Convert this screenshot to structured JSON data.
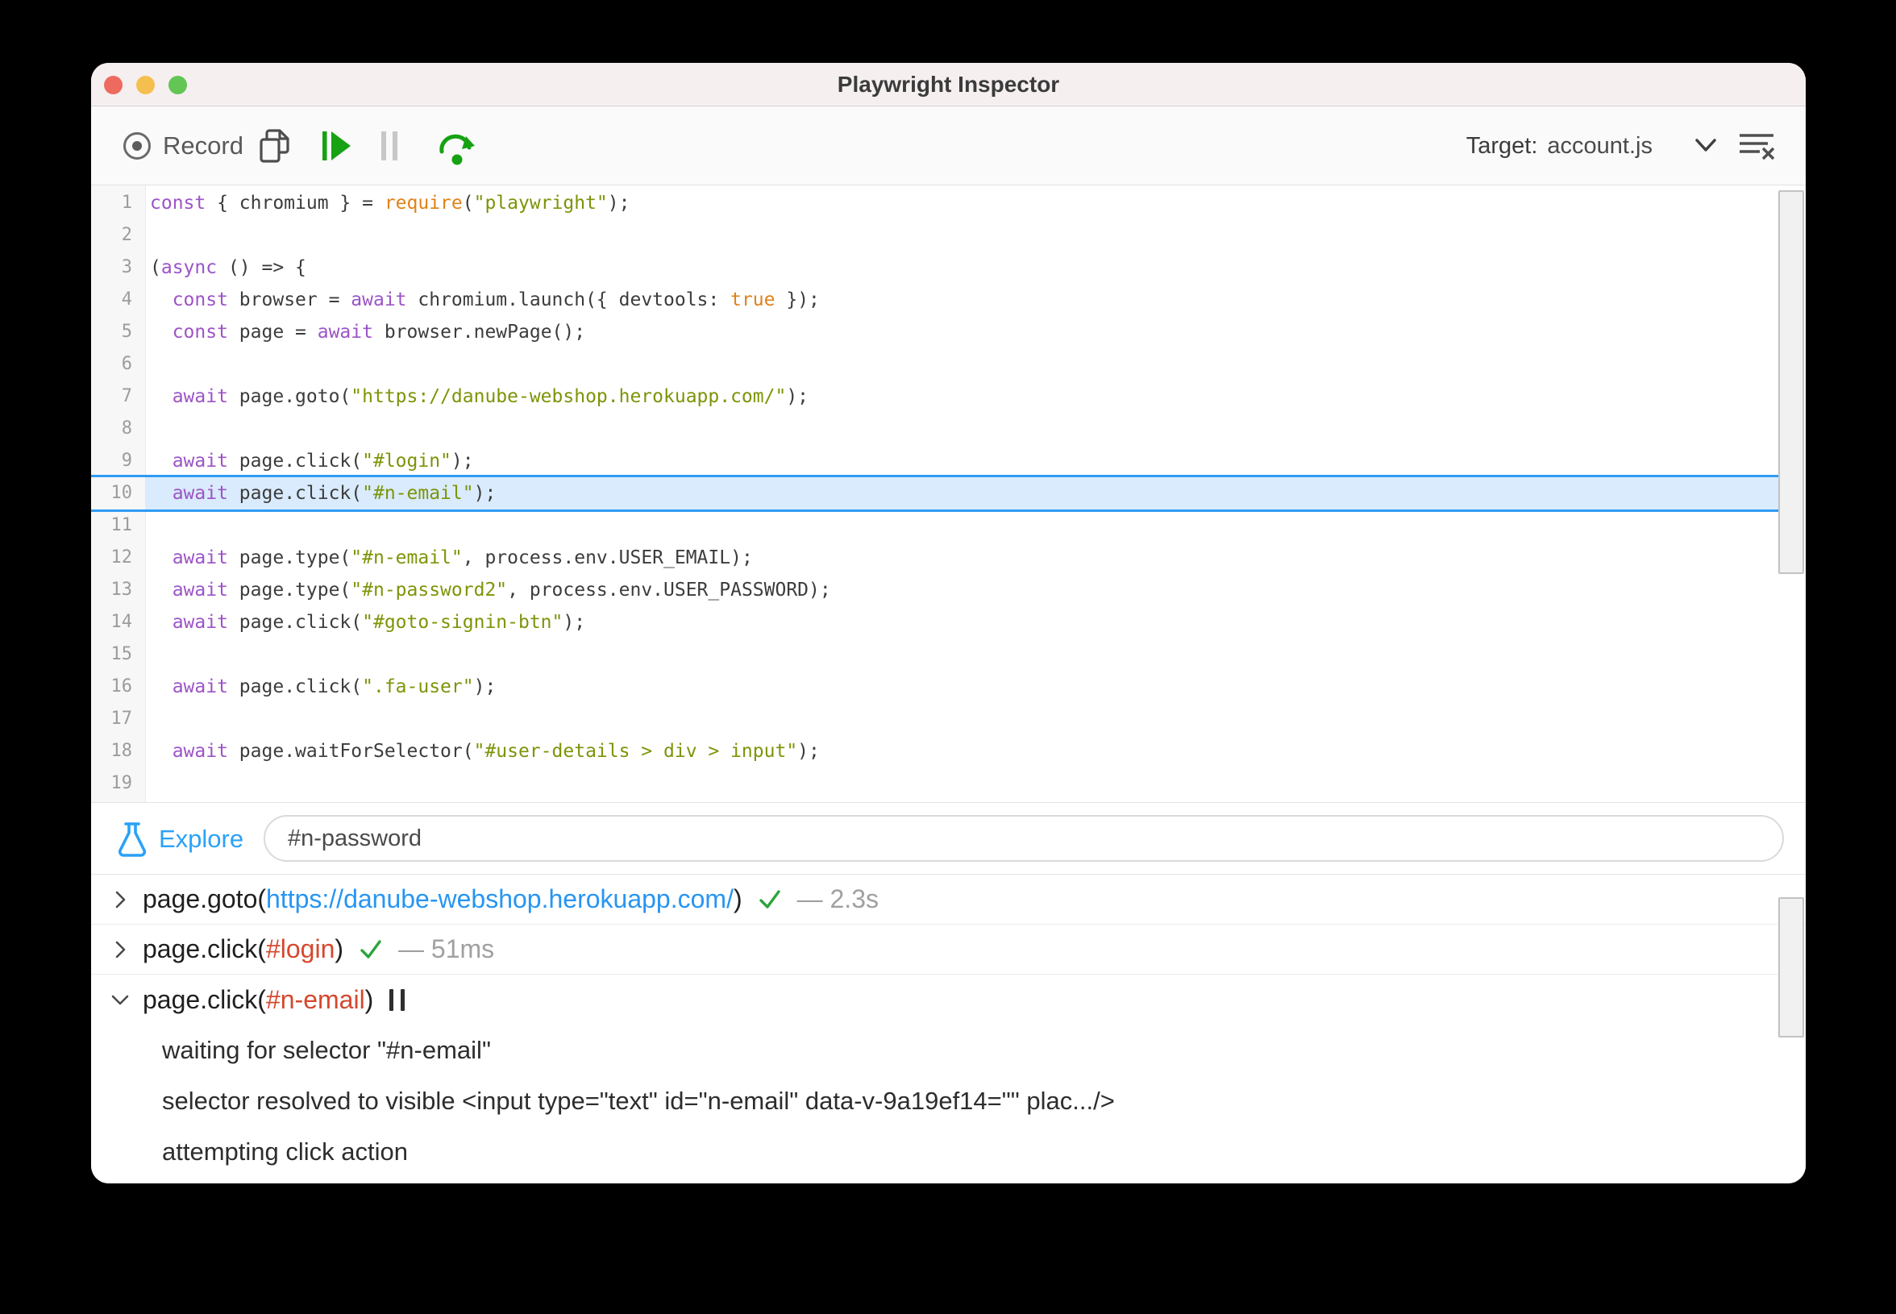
{
  "window": {
    "title": "Playwright Inspector"
  },
  "titlebar_buttons": [
    "close-button",
    "minimize-button",
    "zoom-button"
  ],
  "toolbar": {
    "record_label": "Record",
    "target_label": "Target:",
    "target_value": "account.js",
    "icons": [
      "record-icon",
      "copy-icon",
      "resume-icon",
      "pause-icon",
      "step-over-icon",
      "chevron-down-icon",
      "clear-log-icon"
    ]
  },
  "colors": {
    "accent_blue": "#2aa1f7",
    "link_blue": "#2795f2",
    "selector_red": "#d5482d",
    "success_green": "#2aa53c",
    "action_green": "#16a212",
    "highlight_fill": "#d9ebfc",
    "highlight_border": "#2f9bf5",
    "keyword_purple": "#9c54c6",
    "string_olive": "#7d9408",
    "builtin_orange": "#e08218",
    "traffic_red": "#ed6a5e",
    "traffic_yellow": "#f5bf4f",
    "traffic_green": "#62c554"
  },
  "editor": {
    "active_line": 10,
    "lines": [
      {
        "n": 1,
        "tokens": [
          {
            "t": "const",
            "c": "k"
          },
          {
            "t": " { chromium } = ",
            "c": "p"
          },
          {
            "t": "require",
            "c": "b"
          },
          {
            "t": "(",
            "c": "p"
          },
          {
            "t": "\"playwright\"",
            "c": "s"
          },
          {
            "t": ");",
            "c": "p"
          }
        ]
      },
      {
        "n": 2,
        "tokens": []
      },
      {
        "n": 3,
        "tokens": [
          {
            "t": "(",
            "c": "p"
          },
          {
            "t": "async",
            "c": "k"
          },
          {
            "t": " () => {",
            "c": "p"
          }
        ]
      },
      {
        "n": 4,
        "tokens": [
          {
            "t": "  ",
            "c": "p"
          },
          {
            "t": "const",
            "c": "k"
          },
          {
            "t": " browser = ",
            "c": "p"
          },
          {
            "t": "await",
            "c": "k"
          },
          {
            "t": " chromium.launch({ devtools: ",
            "c": "p"
          },
          {
            "t": "true",
            "c": "b"
          },
          {
            "t": " });",
            "c": "p"
          }
        ]
      },
      {
        "n": 5,
        "tokens": [
          {
            "t": "  ",
            "c": "p"
          },
          {
            "t": "const",
            "c": "k"
          },
          {
            "t": " page = ",
            "c": "p"
          },
          {
            "t": "await",
            "c": "k"
          },
          {
            "t": " browser.newPage();",
            "c": "p"
          }
        ]
      },
      {
        "n": 6,
        "tokens": []
      },
      {
        "n": 7,
        "tokens": [
          {
            "t": "  ",
            "c": "p"
          },
          {
            "t": "await",
            "c": "k"
          },
          {
            "t": " page.goto(",
            "c": "p"
          },
          {
            "t": "\"https://danube-webshop.herokuapp.com/\"",
            "c": "s"
          },
          {
            "t": ");",
            "c": "p"
          }
        ]
      },
      {
        "n": 8,
        "tokens": []
      },
      {
        "n": 9,
        "tokens": [
          {
            "t": "  ",
            "c": "p"
          },
          {
            "t": "await",
            "c": "k"
          },
          {
            "t": " page.click(",
            "c": "p"
          },
          {
            "t": "\"#login\"",
            "c": "s"
          },
          {
            "t": ");",
            "c": "p"
          }
        ]
      },
      {
        "n": 10,
        "tokens": [
          {
            "t": "  ",
            "c": "p"
          },
          {
            "t": "await",
            "c": "k"
          },
          {
            "t": " page.click(",
            "c": "p"
          },
          {
            "t": "\"#n-email\"",
            "c": "s"
          },
          {
            "t": ");",
            "c": "p"
          }
        ]
      },
      {
        "n": 11,
        "tokens": []
      },
      {
        "n": 12,
        "tokens": [
          {
            "t": "  ",
            "c": "p"
          },
          {
            "t": "await",
            "c": "k"
          },
          {
            "t": " page.type(",
            "c": "p"
          },
          {
            "t": "\"#n-email\"",
            "c": "s"
          },
          {
            "t": ", process.env.USER_EMAIL);",
            "c": "p"
          }
        ]
      },
      {
        "n": 13,
        "tokens": [
          {
            "t": "  ",
            "c": "p"
          },
          {
            "t": "await",
            "c": "k"
          },
          {
            "t": " page.type(",
            "c": "p"
          },
          {
            "t": "\"#n-password2\"",
            "c": "s"
          },
          {
            "t": ", process.env.USER_PASSWORD);",
            "c": "p"
          }
        ]
      },
      {
        "n": 14,
        "tokens": [
          {
            "t": "  ",
            "c": "p"
          },
          {
            "t": "await",
            "c": "k"
          },
          {
            "t": " page.click(",
            "c": "p"
          },
          {
            "t": "\"#goto-signin-btn\"",
            "c": "s"
          },
          {
            "t": ");",
            "c": "p"
          }
        ]
      },
      {
        "n": 15,
        "tokens": []
      },
      {
        "n": 16,
        "tokens": [
          {
            "t": "  ",
            "c": "p"
          },
          {
            "t": "await",
            "c": "k"
          },
          {
            "t": " page.click(",
            "c": "p"
          },
          {
            "t": "\".fa-user\"",
            "c": "s"
          },
          {
            "t": ");",
            "c": "p"
          }
        ]
      },
      {
        "n": 17,
        "tokens": []
      },
      {
        "n": 18,
        "tokens": [
          {
            "t": "  ",
            "c": "p"
          },
          {
            "t": "await",
            "c": "k"
          },
          {
            "t": " page.waitForSelector(",
            "c": "p"
          },
          {
            "t": "\"#user-details > div > input\"",
            "c": "s"
          },
          {
            "t": ");",
            "c": "p"
          }
        ]
      },
      {
        "n": 19,
        "tokens": []
      }
    ]
  },
  "explore": {
    "label": "Explore",
    "icon": "flask-icon",
    "input_value": "#n-password"
  },
  "log": {
    "rows": [
      {
        "expanded": false,
        "parts": [
          {
            "t": "page.goto(",
            "c": "plain"
          },
          {
            "t": "https://danube-webshop.herokuapp.com/",
            "c": "link"
          },
          {
            "t": ")",
            "c": "plain"
          }
        ],
        "status": "success",
        "duration": "— 2.3s",
        "details": []
      },
      {
        "expanded": false,
        "parts": [
          {
            "t": "page.click(",
            "c": "plain"
          },
          {
            "t": "#login",
            "c": "selector"
          },
          {
            "t": ")",
            "c": "plain"
          }
        ],
        "status": "success",
        "duration": "— 51ms",
        "details": []
      },
      {
        "expanded": true,
        "parts": [
          {
            "t": "page.click(",
            "c": "plain"
          },
          {
            "t": "#n-email",
            "c": "selector"
          },
          {
            "t": ")",
            "c": "plain"
          }
        ],
        "status": "paused",
        "duration": "",
        "details": [
          "waiting for selector \"#n-email\"",
          "selector resolved to visible <input type=\"text\" id=\"n-email\" data-v-9a19ef14=\"\" plac.../>",
          "attempting click action"
        ]
      }
    ]
  }
}
